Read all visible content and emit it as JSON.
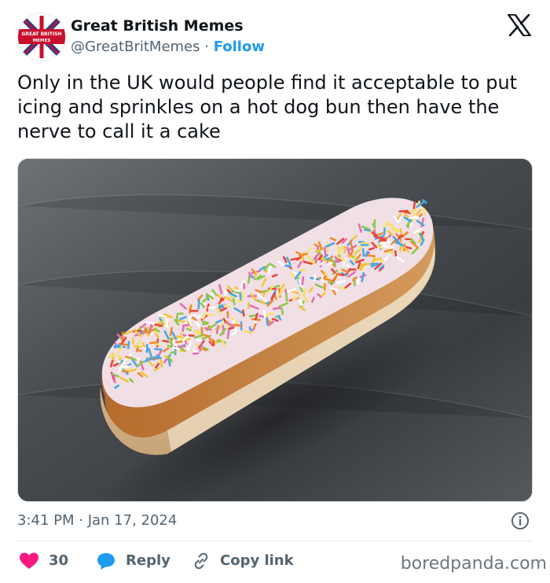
{
  "account": {
    "display_name": "Great British Memes",
    "handle": "@GreatBritMemes",
    "separator": " · ",
    "follow_label": "Follow",
    "avatar_text_line1": "GREAT BRITISH",
    "avatar_text_line2": "MEMES"
  },
  "tweet": {
    "text": "Only in the UK would people find it acceptable to put icing and sprinkles on a hot dog bun then have the nerve to call it a cake",
    "timestamp": "3:41 PM · Jan 17, 2024"
  },
  "actions": {
    "like_count": "30",
    "reply_label": "Reply",
    "copy_label": "Copy link"
  },
  "watermark": "boredpanda.com",
  "icons": {
    "brand": "x-logo-icon",
    "like": "heart-icon",
    "reply": "reply-bubble-icon",
    "copy": "link-icon",
    "info": "info-icon"
  },
  "colors": {
    "accent": "#1d9bf0",
    "like": "#f91880",
    "text": "#0f1419",
    "muted": "#536471"
  }
}
